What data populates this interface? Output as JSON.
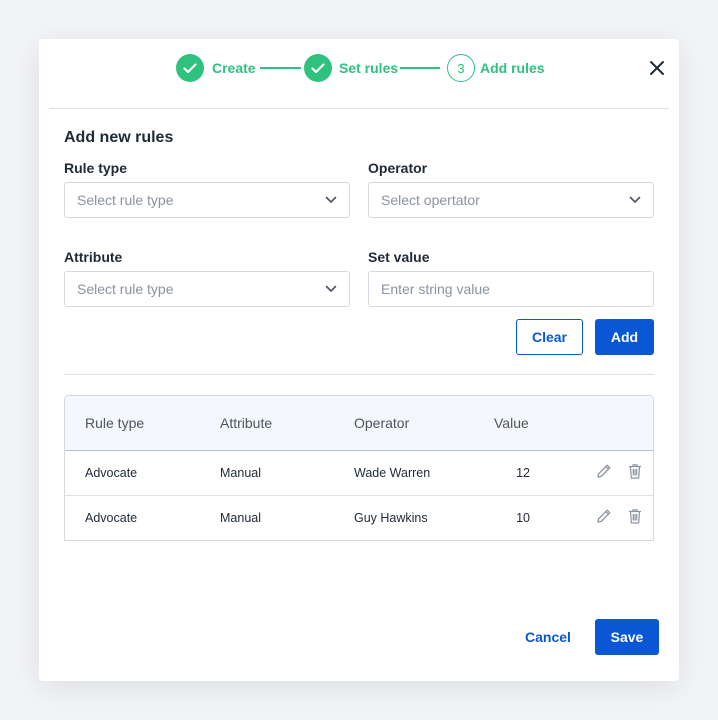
{
  "stepper": {
    "steps": [
      {
        "label": "Create",
        "state": "done"
      },
      {
        "label": "Set rules",
        "state": "done"
      },
      {
        "number": "3",
        "label": "Add rules",
        "state": "active"
      }
    ],
    "color": "#2ec27e"
  },
  "form": {
    "title": "Add new rules",
    "rule_type": {
      "label": "Rule type",
      "placeholder": "Select rule type"
    },
    "operator": {
      "label": "Operator",
      "placeholder": "Select opertator"
    },
    "attribute": {
      "label": "Attribute",
      "placeholder": "Select rule type"
    },
    "set_value": {
      "label": "Set value",
      "placeholder": "Enter string value"
    },
    "clear_label": "Clear",
    "add_label": "Add"
  },
  "table": {
    "headers": [
      "Rule type",
      "Attribute",
      "Operator",
      "Value"
    ],
    "rows": [
      {
        "rule_type": "Advocate",
        "attribute": "Manual",
        "operator": "Wade Warren",
        "value": "12"
      },
      {
        "rule_type": "Advocate",
        "attribute": "Manual",
        "operator": "Guy Hawkins",
        "value": "10"
      }
    ]
  },
  "footer": {
    "cancel_label": "Cancel",
    "save_label": "Save"
  },
  "colors": {
    "primary": "#0a57d6",
    "success": "#2ec27e"
  },
  "icons": [
    "check-icon",
    "close-icon",
    "chevron-down-icon",
    "edit-icon",
    "trash-icon"
  ]
}
